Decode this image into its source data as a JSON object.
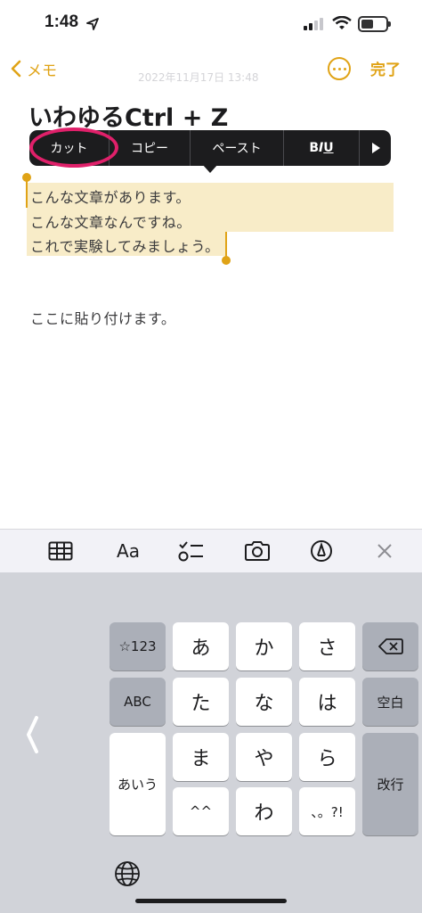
{
  "status_bar": {
    "time": "1:48"
  },
  "nav": {
    "back_label": "メモ",
    "done_label": "完了",
    "faint_date": "2022年11月17日 13:48"
  },
  "note": {
    "title": "いわゆるCtrl + Z",
    "selected_lines": [
      "こんな文章があります。",
      "こんな文章なんですね。",
      "これで実験してみましょう。"
    ],
    "paste_target_line": "ここに貼り付けます。"
  },
  "edit_menu": {
    "cut": "カット",
    "copy": "コピー",
    "paste": "ペースト",
    "format_b": "B",
    "format_i": "I",
    "format_u": "U"
  },
  "toolbar": {
    "format_label": "Aa"
  },
  "keyboard": {
    "row1": {
      "mode": "☆123",
      "k1": "あ",
      "k2": "か",
      "k3": "さ"
    },
    "row2": {
      "mode": "ABC",
      "k1": "た",
      "k2": "な",
      "k3": "は",
      "space": "空白"
    },
    "row3": {
      "mode": "あいう",
      "k1": "ま",
      "k2": "や",
      "k3": "ら",
      "return": "改行"
    },
    "row4": {
      "k1": "^^",
      "k2": "わ",
      "k3": "、。?!"
    }
  },
  "colors": {
    "accent": "#e0a316",
    "selection": "#f8ecc8",
    "annotation": "#e0206a"
  }
}
